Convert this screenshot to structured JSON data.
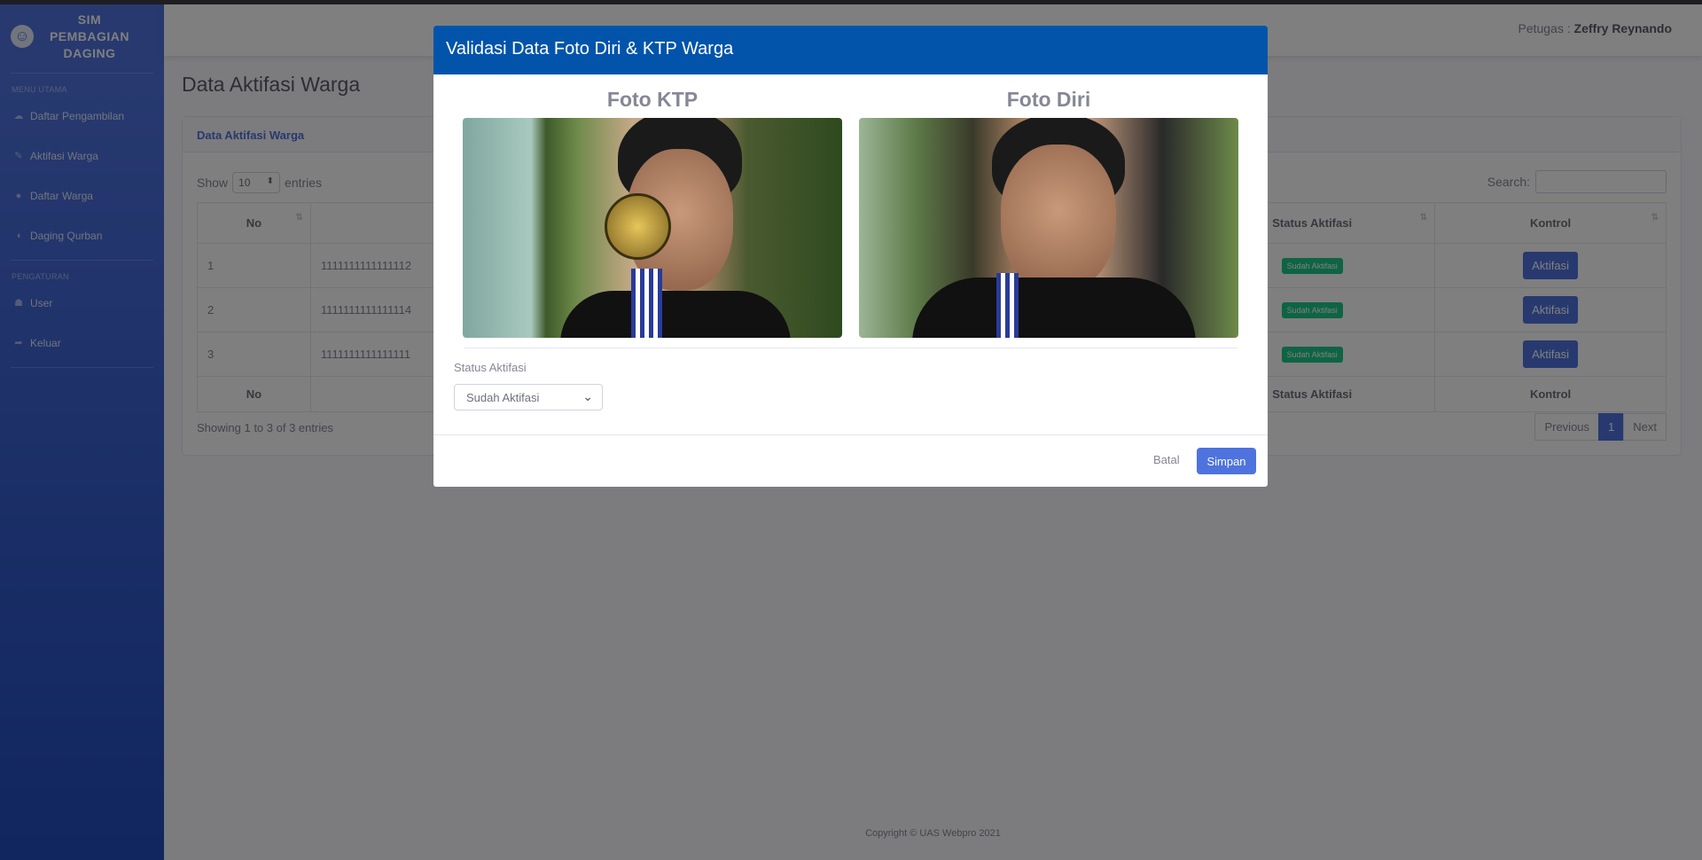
{
  "brand": {
    "title": "SIM PEMBAGIAN DAGING",
    "icon": "laugh-icon"
  },
  "sidebar": {
    "heading_main": "MENU UTAMA",
    "heading_settings": "PENGATURAN",
    "items": [
      {
        "label": "Daftar Pengambilan",
        "icon": "cloud-icon"
      },
      {
        "label": "Aktifasi Warga",
        "icon": "pen-icon"
      },
      {
        "label": "Daftar Warga",
        "icon": "user-icon"
      },
      {
        "label": "Daging Qurban",
        "icon": "drumstick-icon"
      },
      {
        "label": "User",
        "icon": "users-icon"
      },
      {
        "label": "Keluar",
        "icon": "sign-out-icon"
      }
    ]
  },
  "topbar": {
    "officer_label": "Petugas :",
    "officer_name": "Zeffry Reynando"
  },
  "page": {
    "title": "Data Aktifasi Warga"
  },
  "card": {
    "title": "Data Aktifasi Warga",
    "show_label": "Show",
    "entries_label": "entries",
    "length_value": "10",
    "search_label": "Search:",
    "columns": [
      "No",
      "",
      "Status Aktifasi",
      "Kontrol"
    ],
    "rows": [
      {
        "no": "1",
        "nik": "1111111111111112",
        "status": "Sudah Aktifasi",
        "action": "Aktifasi"
      },
      {
        "no": "2",
        "nik": "1111111111111114",
        "status": "Sudah Aktifasi",
        "action": "Aktifasi"
      },
      {
        "no": "3",
        "nik": "1111111111111111",
        "status": "Sudah Aktifasi",
        "action": "Aktifasi"
      }
    ],
    "footer_columns": [
      "No",
      "",
      "Status Aktifasi",
      "Kontrol"
    ],
    "info": "Showing 1 to 3 of 3 entries",
    "pager": {
      "previous": "Previous",
      "current": "1",
      "next": "Next"
    }
  },
  "footer": {
    "copyright": "Copyright © UAS Webpro 2021"
  },
  "modal": {
    "title": "Validasi Data Foto Diri & KTP Warga",
    "photo_ktp_title": "Foto KTP",
    "photo_diri_title": "Foto Diri",
    "status_label": "Status Aktifasi",
    "status_value": "Sudah Aktifasi",
    "cancel_label": "Batal",
    "save_label": "Simpan"
  },
  "colors": {
    "primary": "#4e73df",
    "modal_header": "#0254ab",
    "success": "#1cc88a"
  }
}
